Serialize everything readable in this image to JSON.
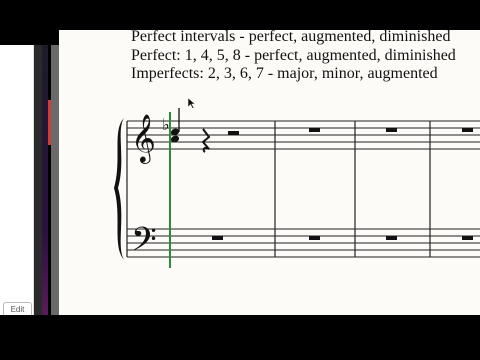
{
  "text": {
    "line_cut": "Perfect intervals - perfect, augmented, diminished",
    "line1": "Perfect: 1, 4, 5, 8 - perfect, augmented, diminished",
    "line2": "Imperfects: 2, 3, 6, 7 - major, minor, augmented"
  },
  "left_panel": {
    "edit_label": "Edit"
  },
  "icons": {
    "cursor": "mouse-pointer-icon",
    "treble": "treble-clef-icon",
    "bass": "bass-clef-icon",
    "brace": "brace-icon",
    "flat": "flat-accidental-icon",
    "rest": "quarter-rest-icon",
    "whole_rest": "whole-rest-icon",
    "half_rest": "half-rest-icon"
  },
  "colors": {
    "playhead": "#2e8b3e",
    "paper": "#fdfbf7",
    "ink": "#111111"
  }
}
